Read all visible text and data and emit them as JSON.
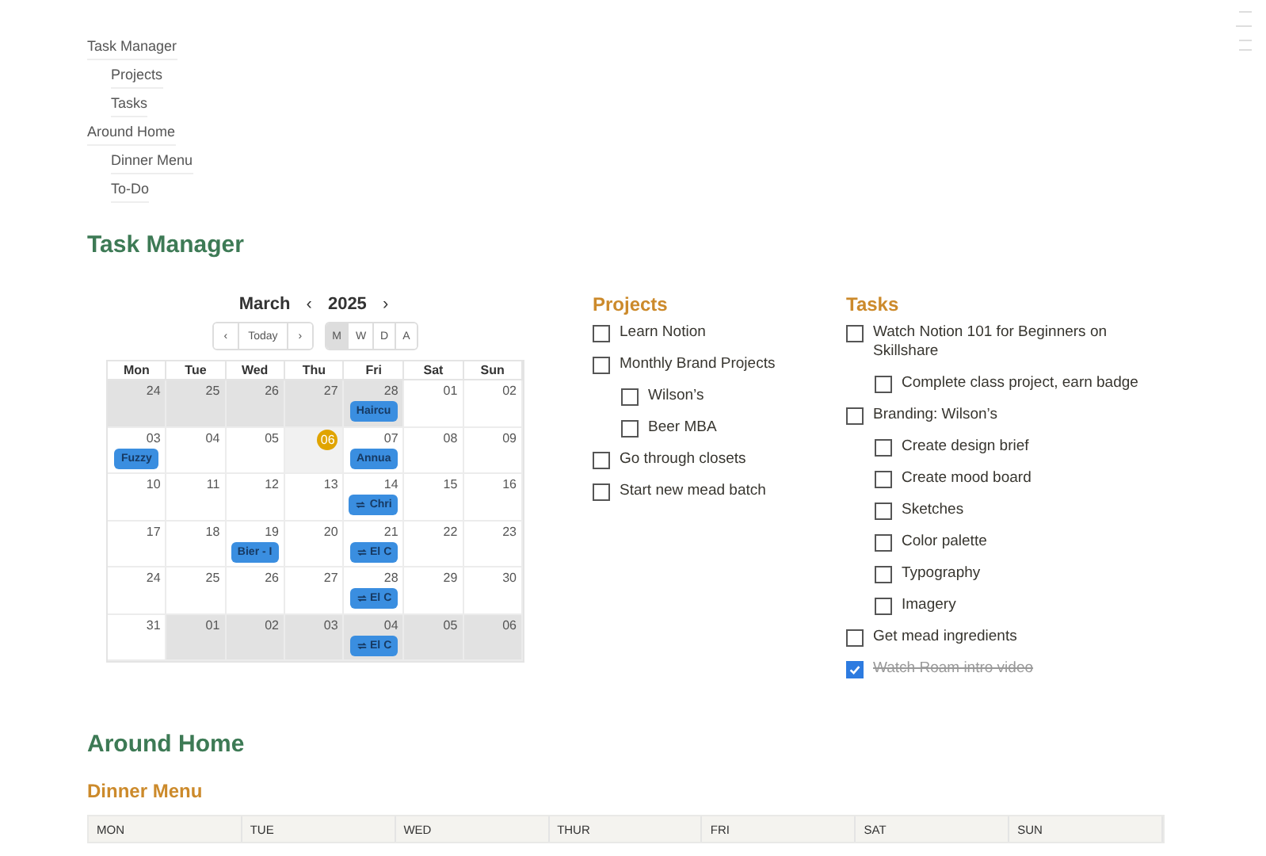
{
  "toc": [
    {
      "label": "Task Manager",
      "children": [
        {
          "label": "Projects"
        },
        {
          "label": "Tasks"
        }
      ]
    },
    {
      "label": "Around Home",
      "children": [
        {
          "label": "Dinner Menu"
        },
        {
          "label": "To-Do"
        }
      ]
    }
  ],
  "task_manager": {
    "title": "Task Manager",
    "calendar": {
      "month": "March",
      "year": "2025",
      "prev": "‹",
      "next": "›",
      "nav": [
        "‹",
        "Today",
        "›"
      ],
      "views": [
        {
          "label": "M",
          "selected": true
        },
        {
          "label": "W",
          "selected": false
        },
        {
          "label": "D",
          "selected": false
        },
        {
          "label": "A",
          "selected": false
        }
      ],
      "weekdays": [
        "Mon",
        "Tue",
        "Wed",
        "Thu",
        "Fri",
        "Sat",
        "Sun"
      ],
      "weeks": [
        [
          {
            "day": "24",
            "outside": true
          },
          {
            "day": "25",
            "outside": true
          },
          {
            "day": "26",
            "outside": true
          },
          {
            "day": "27",
            "outside": true
          },
          {
            "day": "28",
            "outside": true,
            "events": [
              {
                "title": "Haircu",
                "recurring": false
              }
            ]
          },
          {
            "day": "01",
            "outside": false
          },
          {
            "day": "02",
            "outside": false
          }
        ],
        [
          {
            "day": "03",
            "outside": false,
            "events": [
              {
                "title": "Fuzzy",
                "recurring": false
              }
            ]
          },
          {
            "day": "04",
            "outside": false
          },
          {
            "day": "05",
            "outside": false
          },
          {
            "day": "06",
            "outside": false,
            "today": true
          },
          {
            "day": "07",
            "outside": false,
            "events": [
              {
                "title": "Annua",
                "recurring": false
              }
            ]
          },
          {
            "day": "08",
            "outside": false
          },
          {
            "day": "09",
            "outside": false
          }
        ],
        [
          {
            "day": "10",
            "outside": false
          },
          {
            "day": "11",
            "outside": false
          },
          {
            "day": "12",
            "outside": false
          },
          {
            "day": "13",
            "outside": false
          },
          {
            "day": "14",
            "outside": false,
            "events": [
              {
                "title": "Chri",
                "recurring": true
              }
            ]
          },
          {
            "day": "15",
            "outside": false
          },
          {
            "day": "16",
            "outside": false
          }
        ],
        [
          {
            "day": "17",
            "outside": false
          },
          {
            "day": "18",
            "outside": false
          },
          {
            "day": "19",
            "outside": false,
            "events": [
              {
                "title": "Bier - I",
                "recurring": false
              }
            ]
          },
          {
            "day": "20",
            "outside": false
          },
          {
            "day": "21",
            "outside": false,
            "events": [
              {
                "title": "El C",
                "recurring": true
              }
            ]
          },
          {
            "day": "22",
            "outside": false
          },
          {
            "day": "23",
            "outside": false
          }
        ],
        [
          {
            "day": "24",
            "outside": false
          },
          {
            "day": "25",
            "outside": false
          },
          {
            "day": "26",
            "outside": false
          },
          {
            "day": "27",
            "outside": false
          },
          {
            "day": "28",
            "outside": false,
            "events": [
              {
                "title": "El C",
                "recurring": true
              }
            ]
          },
          {
            "day": "29",
            "outside": false
          },
          {
            "day": "30",
            "outside": false
          }
        ],
        [
          {
            "day": "31",
            "outside": false
          },
          {
            "day": "01",
            "outside": true
          },
          {
            "day": "02",
            "outside": true
          },
          {
            "day": "03",
            "outside": true
          },
          {
            "day": "04",
            "outside": true,
            "events": [
              {
                "title": "El C",
                "recurring": true
              }
            ]
          },
          {
            "day": "05",
            "outside": true
          },
          {
            "day": "06",
            "outside": true
          }
        ]
      ]
    },
    "projects": {
      "title": "Projects",
      "items": [
        {
          "label": "Learn Notion",
          "checked": false
        },
        {
          "label": "Monthly Brand Projects",
          "checked": false,
          "children": [
            {
              "label": "Wilson’s",
              "checked": false
            },
            {
              "label": "Beer MBA",
              "checked": false
            }
          ]
        },
        {
          "label": "Go through closets",
          "checked": false
        },
        {
          "label": "Start new mead batch",
          "checked": false
        }
      ]
    },
    "tasks": {
      "title": "Tasks",
      "items": [
        {
          "label": "Watch Notion 101 for Beginners on Skillshare",
          "checked": false,
          "children": [
            {
              "label": "Complete class project, earn badge",
              "checked": false
            }
          ]
        },
        {
          "label": "Branding: Wilson’s",
          "checked": false,
          "children": [
            {
              "label": "Create design brief",
              "checked": false
            },
            {
              "label": "Create mood board",
              "checked": false
            },
            {
              "label": "Sketches",
              "checked": false
            },
            {
              "label": "Color palette",
              "checked": false
            },
            {
              "label": "Typography",
              "checked": false
            },
            {
              "label": "Imagery",
              "checked": false
            }
          ]
        },
        {
          "label": "Get mead ingredients",
          "checked": false
        },
        {
          "label": "Watch Roam intro video",
          "checked": true
        }
      ]
    }
  },
  "around_home": {
    "title": "Around Home",
    "dinner_menu": {
      "title": "Dinner Menu",
      "columns": [
        "MON",
        "TUE",
        "WED",
        "THUR",
        "FRI",
        "SAT",
        "SUN"
      ]
    }
  }
}
